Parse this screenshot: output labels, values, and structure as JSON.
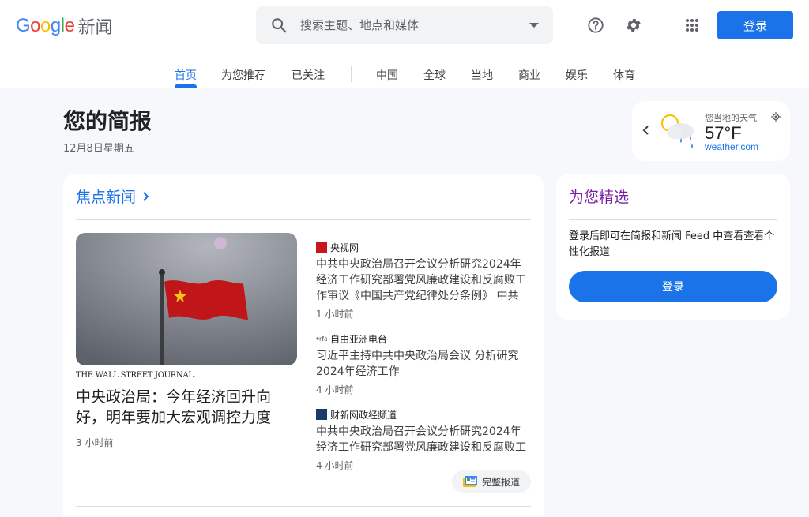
{
  "header": {
    "logo_letters": [
      "G",
      "o",
      "o",
      "g",
      "l",
      "e"
    ],
    "logo_product": "新闻",
    "search_placeholder": "搜索主题、地点和媒体",
    "signin_label": "登录",
    "help_icon": "help-icon",
    "settings_icon": "gear-icon",
    "apps_icon": "apps-grid-icon"
  },
  "tabs": [
    {
      "label": "首页",
      "active": true
    },
    {
      "label": "为您推荐"
    },
    {
      "label": "已关注"
    },
    {
      "label": "中国"
    },
    {
      "label": "全球"
    },
    {
      "label": "当地"
    },
    {
      "label": "商业"
    },
    {
      "label": "娱乐"
    },
    {
      "label": "体育"
    }
  ],
  "briefing": {
    "title": "您的简报",
    "date": "12月8日星期五"
  },
  "weather": {
    "label": "您当地的天气",
    "temp": "57°F",
    "source": "weather.com",
    "condition_icon": "partly-cloudy-rain-icon"
  },
  "top_stories": {
    "title": "焦点新闻",
    "hero": {
      "source": "THE WALL STREET JOURNAL.",
      "title": "中央政治局：今年经济回升向好，明年要加大宏观调控力度",
      "time": "3 小时前",
      "image": "red-flag-photo"
    },
    "stories": [
      {
        "source": "央视网",
        "title": "中共中央政治局召开会议分析研究2024年经济工作研究部署党风廉政建设和反腐败工作审议《中国共产党纪律处分条例》 中共中…",
        "time": "1 小时前",
        "favicon_color": "#c8161d"
      },
      {
        "source": "自由亚洲电台",
        "title": "习近平主持中共中央政治局会议 分析研究2024年经济工作",
        "time": "4 小时前",
        "favicon_color": "#2e7d32"
      },
      {
        "source": "财新网政经频道",
        "title": "中共中央政治局召开会议分析研究2024年经济工作研究部署党风廉政建设和反腐败工作",
        "time": "4 小时前",
        "favicon_color": "#1a3a6b"
      }
    ],
    "full_coverage_label": "完整报道"
  },
  "picks": {
    "title": "为您精选",
    "text": "登录后即可在简报和新闻 Feed 中查看查看个性化报道",
    "button": "登录"
  }
}
